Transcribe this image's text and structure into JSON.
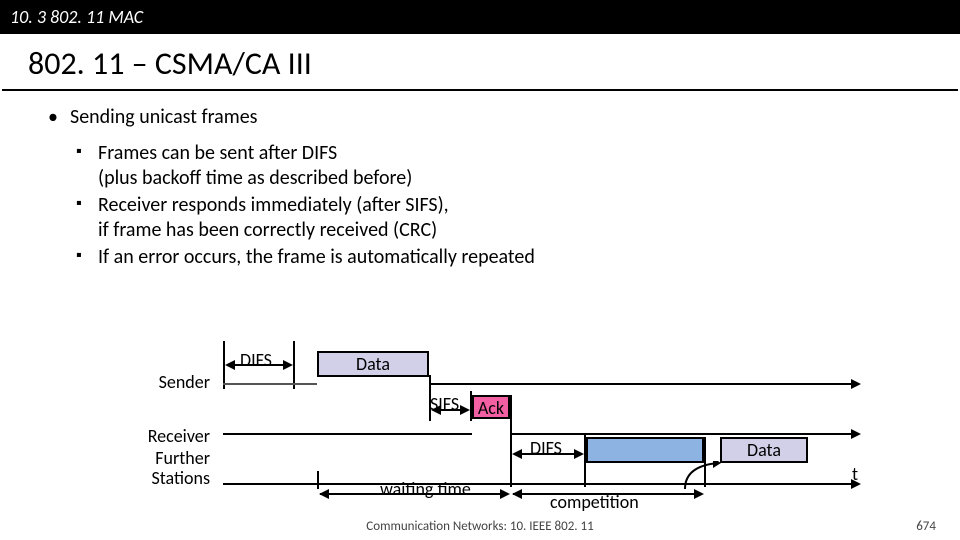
{
  "header": "10. 3 802. 11 MAC",
  "title": "802. 11 – CSMA/CA III",
  "main_bullet": "Sending unicast frames",
  "sub_bullets": {
    "b1": "Frames can be sent after DIFS\n(plus backoff time as described before)",
    "b2": "Receiver responds immediately (after SIFS),\nif frame has been correctly received (CRC)",
    "b3": "If an error occurs, the frame is automatically repeated"
  },
  "labels": {
    "sender": "Sender",
    "receiver": "Receiver",
    "further": "Further\nStations",
    "difs1": "DIFS",
    "difs2": "DIFS",
    "sifs": "SIFS",
    "data1": "Data",
    "data2": "Data",
    "ack": "Ack",
    "waiting": "waiting time",
    "competition": "competition",
    "t": "t"
  },
  "footer": "Communication Networks: 10. IEEE 802. 11",
  "pagenum": "674"
}
